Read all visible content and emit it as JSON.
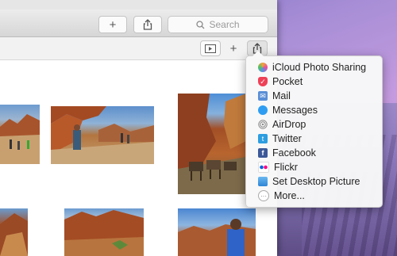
{
  "toolbar": {
    "add_label": "+",
    "share_label": "⇧",
    "search_placeholder": "Search"
  },
  "subtoolbar": {
    "slideshow_label": "▶",
    "add_label": "+",
    "share_label": "⇧"
  },
  "share_menu": {
    "items": [
      {
        "label": "iCloud Photo Sharing",
        "icon": "icloud-photo-sharing-icon",
        "color": "#f2a33a"
      },
      {
        "label": "Pocket",
        "icon": "pocket-icon",
        "color": "#ee4056"
      },
      {
        "label": "Mail",
        "icon": "mail-icon",
        "color": "#5a8fd6"
      },
      {
        "label": "Messages",
        "icon": "messages-icon",
        "color": "#2f9df2"
      },
      {
        "label": "AirDrop",
        "icon": "airdrop-icon",
        "color": "#9a9a9a"
      },
      {
        "label": "Twitter",
        "icon": "twitter-icon",
        "color": "#2d9ee0"
      },
      {
        "label": "Facebook",
        "icon": "facebook-icon",
        "color": "#3b5998"
      },
      {
        "label": "Flickr",
        "icon": "flickr-icon",
        "color": "#ff0084"
      },
      {
        "label": "Set Desktop Picture",
        "icon": "desktop-picture-icon",
        "color": "#3aa0e8"
      },
      {
        "label": "More...",
        "icon": "more-icon",
        "color": "#b0b0b0"
      }
    ]
  }
}
